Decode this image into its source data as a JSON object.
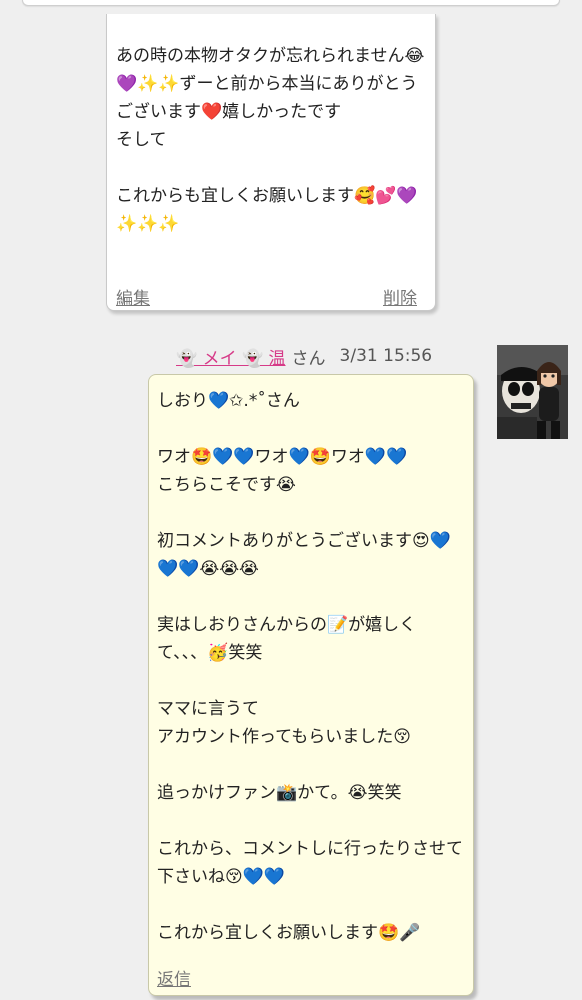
{
  "previous_comment": {
    "text": "あの時の本物オタクが忘れられません😂💜✨✨ずーと前から本当にありがとうございます❤️嬉しかったです\nそして\n\nこれからも宜しくお願いします🥰💕💜✨✨✨",
    "edit_label": "編集",
    "delete_label": "削除"
  },
  "comment": {
    "author_display": "👻 メイ 👻 温",
    "author_suffix": "さん",
    "date": "3/31 15:56",
    "text": "しおり💙✩.*˚さん\n\nワオ🤩💙💙ワオ💙🤩ワオ💙💙\nこちらこそです😭\n\n初コメントありがとうございます😍💙💙💙😭😭😭\n\n実はしおりさんからの📝が嬉しくて、、、🥳笑笑\n\nママに言うて\nアカウント作ってもらいました😚\n\n追っかけファン📸かて。😭笑笑\n\nこれから、コメントしに行ったりさせて下さいね😚💙💙\n\nこれから宜しくお願いします🤩🎤",
    "reply_label": "返信"
  },
  "colors": {
    "background": "#efefef",
    "bubble": "#fffee4",
    "name": "#d63a88",
    "link": "#777777"
  }
}
